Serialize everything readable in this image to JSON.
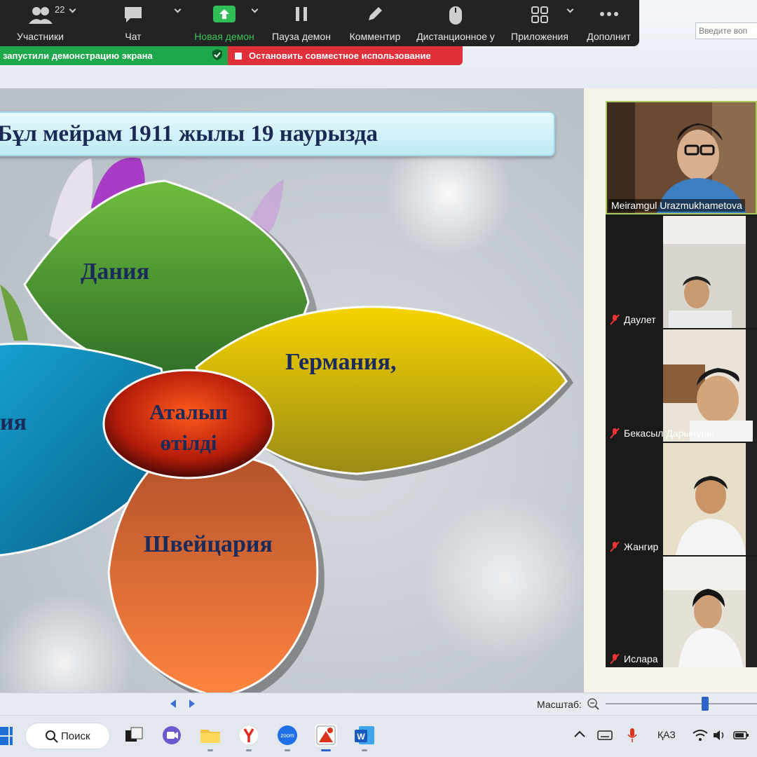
{
  "toolbar": {
    "participants_label": "Участники",
    "participants_count": "22",
    "chat_label": "Чат",
    "share_label": "Новая демон",
    "pause_label": "Пауза демон",
    "annotate_label": "Комментир",
    "remote_label": "Дистанционное у",
    "apps_label": "Приложения",
    "more_label": "Дополнит"
  },
  "share_bar": {
    "status_text": "запустили демонстрацию экрана",
    "stop_text": "Остановить совместное использование"
  },
  "ribbon": {
    "search_placeholder": "Введите воп"
  },
  "slide": {
    "title": "Бұл мейрам 1911 жылы 19 наурызда",
    "petals": {
      "top": "Дания",
      "right": "Германия,",
      "left": "ия",
      "bottom": "Швейцария"
    },
    "center_line1": "Аталып",
    "center_line2": "өтілді"
  },
  "participants": [
    {
      "name": "Meiramgul Urazmukhametova",
      "muted": false
    },
    {
      "name": "Даулет",
      "muted": true
    },
    {
      "name": "Бекасыл Дарынұлы",
      "muted": true
    },
    {
      "name": "Жангир",
      "muted": true
    },
    {
      "name": "Ислара",
      "muted": true
    }
  ],
  "statusbar": {
    "zoom_label": "Масштаб:"
  },
  "taskbar": {
    "search_label": "Поиск",
    "language": "ҚАЗ"
  },
  "colors": {
    "toolbar_bg": "#232323",
    "share_green": "#1ea84b",
    "stop_red": "#e0303a",
    "petal_green": "#3f8f2f",
    "petal_yellow": "#e1b400",
    "petal_blue": "#0a88b5",
    "petal_orange": "#e46a2b",
    "center_red": "#b51c0a"
  }
}
